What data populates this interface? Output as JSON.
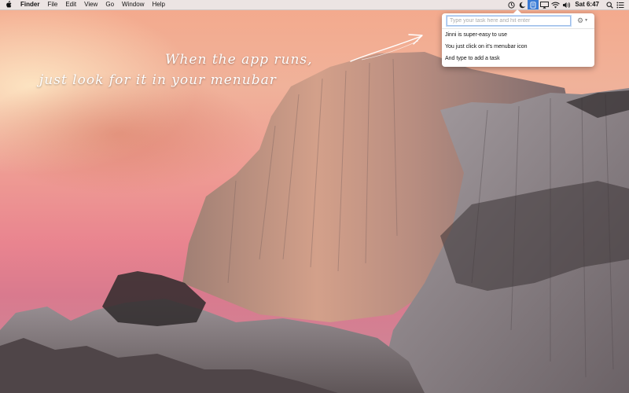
{
  "menubar": {
    "apple_icon": "apple-icon",
    "app_name": "Finder",
    "menus": [
      "File",
      "Edit",
      "View",
      "Go",
      "Window",
      "Help"
    ],
    "status_icons": [
      "timer-icon",
      "moon-icon",
      "jinni-app-icon",
      "airplay-icon",
      "wifi-icon",
      "volume-icon"
    ],
    "clock": "Sat 6:47",
    "right_icons": [
      "spotlight-search-icon",
      "notification-center-icon"
    ]
  },
  "popover": {
    "input_placeholder": "Type your task here and hit enter",
    "settings_icon": "gear-icon",
    "tasks": [
      "Jinni is super-easy to use",
      "You just click on it's menubar icon",
      "And type to add a task"
    ]
  },
  "caption": {
    "line1": "When the app runs,",
    "line2": "just look for it in your menubar"
  },
  "colors": {
    "active_menubar_icon": "#3a7bd5",
    "sky_top": "#f4a98c",
    "sky_bottom": "#d97a8e",
    "rock": "#7a6e70"
  }
}
